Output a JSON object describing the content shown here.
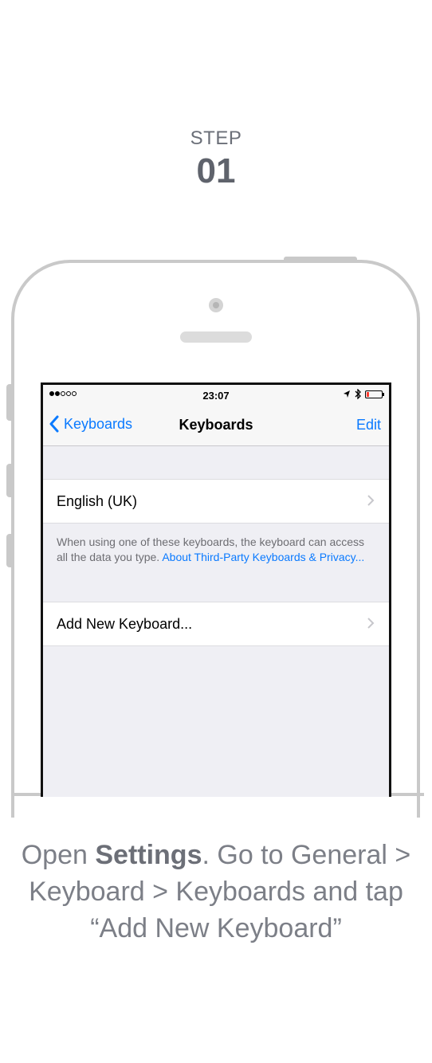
{
  "step": {
    "label": "STEP",
    "number": "01"
  },
  "status_bar": {
    "time": "23:07"
  },
  "nav": {
    "back_label": "Keyboards",
    "title": "Keyboards",
    "edit_label": "Edit"
  },
  "keyboards": {
    "items": [
      "English (UK)"
    ],
    "footer_text": "When using one of these keyboards, the keyboard can access all the data you type. ",
    "footer_link": "About Third-Party Keyboards & Privacy..."
  },
  "add_keyboard_label": "Add New Keyboard...",
  "caption": {
    "part1": "Open ",
    "bold": "Settings",
    "part2": ". Go to General >",
    "line2": "Keyboard > Keyboards and tap",
    "line3": "“Add New Keyboard”"
  },
  "colors": {
    "accent": "#0a7aff",
    "battery_low": "#ff3b30"
  },
  "icons": [
    "back-chevron-icon",
    "location-arrow-icon",
    "bluetooth-icon",
    "battery-icon",
    "chevron-right-icon"
  ]
}
